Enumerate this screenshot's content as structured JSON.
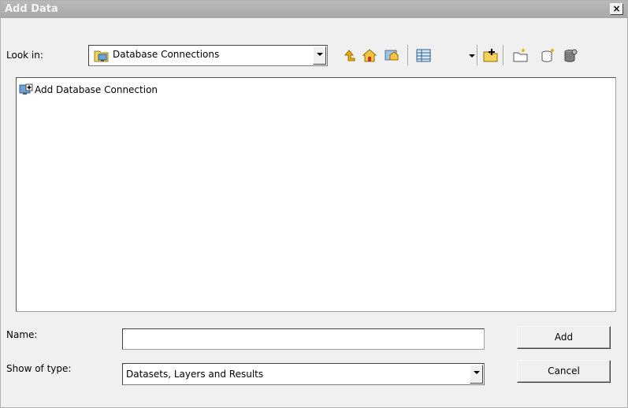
{
  "window": {
    "title": "Add Data",
    "close_glyph": "×"
  },
  "toolbar": {
    "look_in_label": "Look in:",
    "look_in_value": "Database Connections",
    "icons": [
      "up-one-level-icon",
      "home-icon",
      "folder-connection-icon",
      "view-menu-icon",
      "connect-folder-icon",
      "new-folder-icon",
      "new-geodatabase-icon",
      "catalog-options-icon"
    ]
  },
  "file_list": {
    "items": [
      {
        "label": "Add Database Connection",
        "icon": "add-database-connection-icon"
      }
    ]
  },
  "bottom": {
    "name_label": "Name:",
    "name_value": "",
    "type_label": "Show of type:",
    "type_value": "Datasets, Layers and Results",
    "add_label": "Add",
    "cancel_label": "Cancel"
  },
  "colors": {
    "titlebar": "#a8a8a8",
    "dialog_bg": "#f0f0f0",
    "folder_yellow": "#f5d259",
    "arrow_yellow": "#e8b400"
  }
}
